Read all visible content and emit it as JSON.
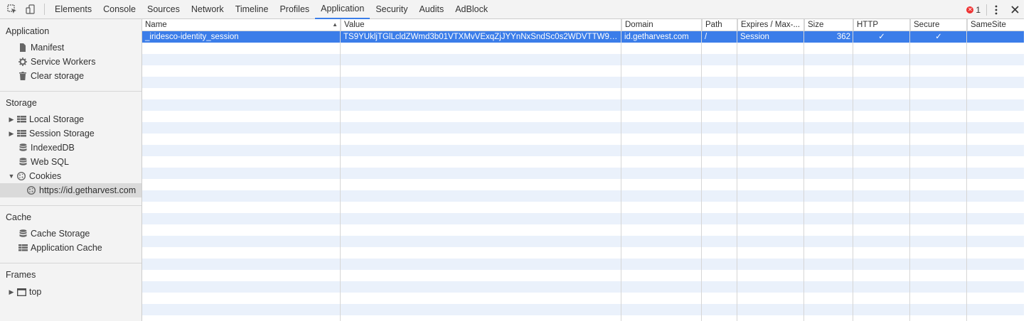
{
  "toolbar": {
    "tabs": [
      "Elements",
      "Console",
      "Sources",
      "Network",
      "Timeline",
      "Profiles",
      "Application",
      "Security",
      "Audits",
      "AdBlock"
    ],
    "active_tab": "Application",
    "error_count": "1",
    "icons": [
      "inspect-element-icon",
      "device-mode-icon",
      "kebab-menu-icon",
      "close-icon"
    ]
  },
  "sidebar": {
    "sections": {
      "application": {
        "title": "Application",
        "items": [
          "Manifest",
          "Service Workers",
          "Clear storage"
        ]
      },
      "storage": {
        "title": "Storage",
        "items": [
          "Local Storage",
          "Session Storage",
          "IndexedDB",
          "Web SQL",
          "Cookies"
        ],
        "cookie_child": "https://id.getharvest.com"
      },
      "cache": {
        "title": "Cache",
        "items": [
          "Cache Storage",
          "Application Cache"
        ]
      },
      "frames": {
        "title": "Frames",
        "items": [
          "top"
        ]
      }
    }
  },
  "table": {
    "columns": [
      "Name",
      "Value",
      "Domain",
      "Path",
      "Expires / Max-...",
      "Size",
      "HTTP",
      "Secure",
      "SameSite"
    ],
    "sorted_column": "Name",
    "rows": [
      {
        "name": "_iridesco-identity_session",
        "value": "TS9YUkljTGlLcldZWmd3b01VTXMvVExqZjJYYnNxSndSc0s2WDVTTW9WN...",
        "domain": "id.getharvest.com",
        "path": "/",
        "expires": "Session",
        "size": "362",
        "http": "✓",
        "secure": "✓",
        "samesite": ""
      }
    ]
  },
  "colors": {
    "selection": "#3b7de9",
    "stripe": "#eaf1fb",
    "error": "#e33333"
  }
}
